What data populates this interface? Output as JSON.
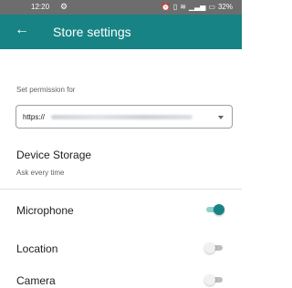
{
  "status_bar": {
    "time": "12:20",
    "left_icon": "gear-icon",
    "right_icons": [
      "alarm-icon",
      "vibrate-icon",
      "wifi-icon",
      "signal-icon"
    ],
    "battery": "32%"
  },
  "app_bar": {
    "title": "Store settings",
    "back_icon": "arrow-left-icon",
    "color": "#178385"
  },
  "permission": {
    "label": "Set permission for",
    "url_prefix": "https://"
  },
  "device_storage": {
    "title": "Device Storage",
    "subtitle": "Ask every time"
  },
  "permissions": [
    {
      "label": "Microphone",
      "enabled": true
    },
    {
      "label": "Location",
      "enabled": false
    },
    {
      "label": "Camera",
      "enabled": false
    }
  ]
}
